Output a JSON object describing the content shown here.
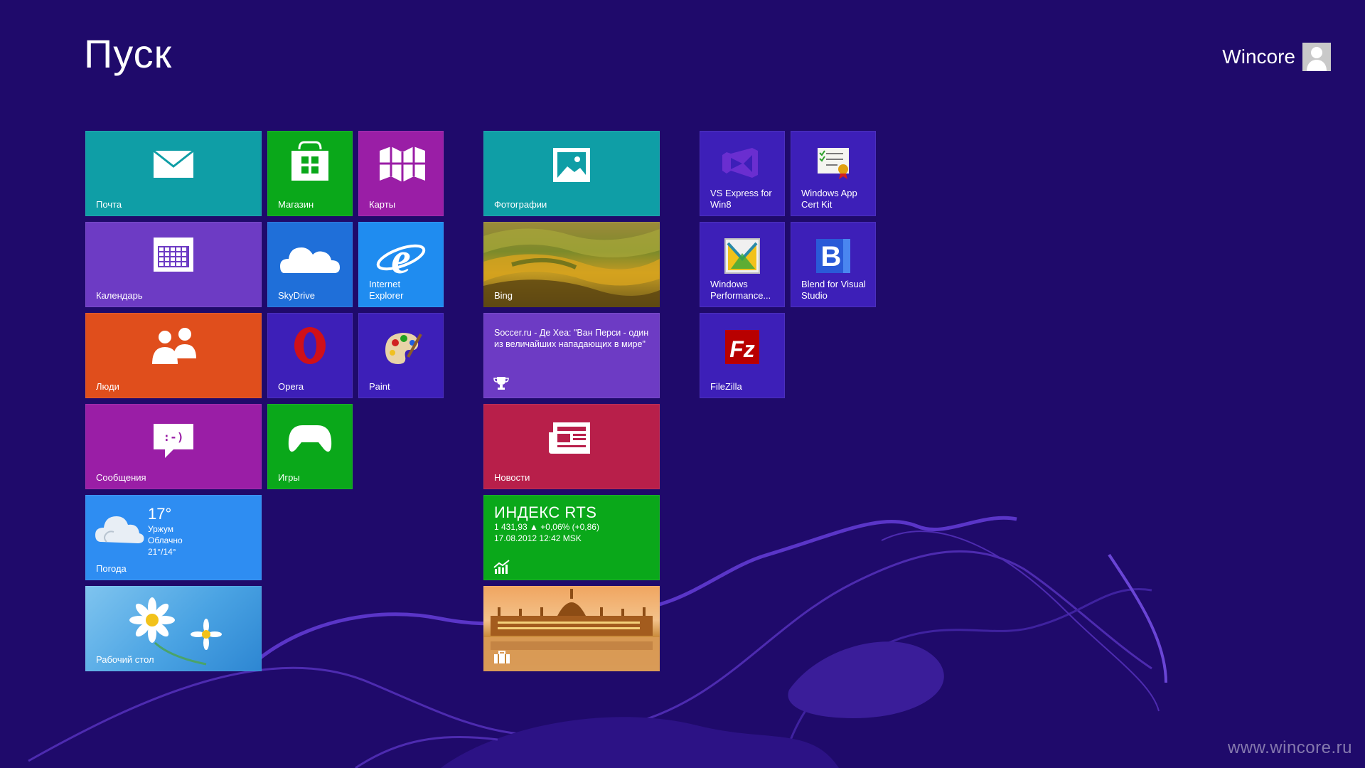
{
  "title": "Пуск",
  "user": {
    "name": "Wincore"
  },
  "watermark": "www.wincore.ru",
  "colors": {
    "background": "#1f0a6b",
    "teal": "#0f9ea6",
    "green": "#0aa81a",
    "magenta": "#9a1ea6",
    "purple": "#6d3bc4",
    "blue": "#1f6fd9",
    "orange": "#e04e1c",
    "crimson": "#b81f4a",
    "indigo": "#3d1fb8"
  },
  "tiles": {
    "mail": {
      "label": "Почта",
      "icon": "mail-icon"
    },
    "store": {
      "label": "Магазин",
      "icon": "store-icon"
    },
    "maps": {
      "label": "Карты",
      "icon": "maps-icon"
    },
    "calendar": {
      "label": "Календарь",
      "icon": "calendar-icon"
    },
    "skydrive": {
      "label": "SkyDrive",
      "icon": "cloud-icon"
    },
    "ie": {
      "label": "Internet Explorer",
      "icon": "internet-explorer-icon"
    },
    "people": {
      "label": "Люди",
      "icon": "people-icon"
    },
    "opera": {
      "label": "Opera",
      "icon": "opera-icon"
    },
    "paint": {
      "label": "Paint",
      "icon": "paint-palette-icon"
    },
    "messaging": {
      "label": "Сообщения",
      "icon": "chat-bubble-icon"
    },
    "games": {
      "label": "Игры",
      "icon": "gamepad-icon"
    },
    "weather": {
      "label": "Погода",
      "temp": "17°",
      "city": "Уржум",
      "condition": "Облачно",
      "range": "21°/14°",
      "icon": "cloud-sun-icon"
    },
    "desktop": {
      "label": "Рабочий стол",
      "icon": "desktop-wallpaper"
    },
    "photos": {
      "label": "Фотографии",
      "icon": "photo-icon"
    },
    "bing": {
      "label": "Bing",
      "icon": "bing-landscape"
    },
    "sports": {
      "headline": "Soccer.ru - Де Хеа: \"Ван Перси - один из величайших нападающих в мире\"",
      "icon": "trophy-icon"
    },
    "news": {
      "label": "Новости",
      "icon": "newspaper-icon"
    },
    "finance": {
      "title": "ИНДЕКС RTS",
      "quote": "1 431,93 ▲ +0,06% (+0,86)",
      "date": "17.08.2012 12:42 MSK",
      "icon": "chart-up-icon"
    },
    "travel": {
      "icon": "suitcase-icon"
    },
    "vs": {
      "label": "VS Express for Win8",
      "icon": "visual-studio-icon"
    },
    "certkit": {
      "label": "Windows App Cert Kit",
      "icon": "certificate-icon"
    },
    "perf": {
      "label": "Windows Performance...",
      "icon": "performance-icon"
    },
    "blend": {
      "label": "Blend for Visual Studio",
      "icon": "blend-icon"
    },
    "filezilla": {
      "label": "FileZilla",
      "icon": "filezilla-icon"
    }
  }
}
